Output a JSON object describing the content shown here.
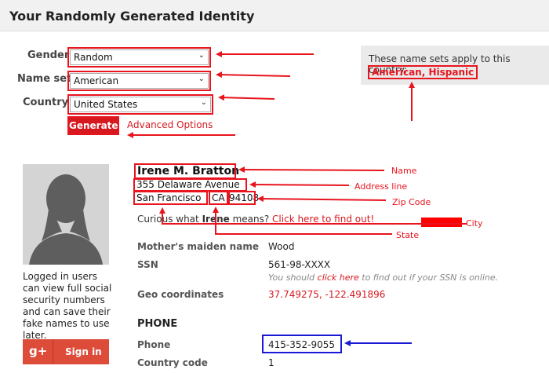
{
  "header": {
    "title": "Your Randomly Generated Identity"
  },
  "form": {
    "gender_label": "Gender",
    "gender_value": "Random",
    "nameset_label": "Name set",
    "nameset_value": "American",
    "country_label": "Country",
    "country_value": "United States",
    "generate_label": "Generate",
    "advanced_label": "Advanced Options"
  },
  "note": {
    "text": "These name sets apply to this country:",
    "value": "American, Hispanic"
  },
  "sidebar": {
    "text": "Logged in users can view full social security numbers and can save their fake names to use later.",
    "gplus_glyph": "g+",
    "signin_label": "Sign in"
  },
  "person": {
    "name": "Irene M. Bratton",
    "address_line": "355 Delaware Avenue",
    "city": "San Francisco",
    "state": "CA",
    "zip": "94108",
    "curious_prefix": "Curious what ",
    "curious_name": "Irene",
    "curious_mid": " means? ",
    "curious_link": "Click here to find out!"
  },
  "details": {
    "maiden_label": "Mother's maiden name",
    "maiden_value": "Wood",
    "ssn_label": "SSN",
    "ssn_value": "561-98-XXXX",
    "ssn_note_prefix": "You should ",
    "ssn_note_link": "click here",
    "ssn_note_suffix": " to find out if your SSN is online.",
    "geo_label": "Geo coordinates",
    "geo_value": "37.749275, -122.491896",
    "phone_section": "PHONE",
    "phone_label": "Phone",
    "phone_value": "415-352-9055",
    "cc_label": "Country code",
    "cc_value": "1"
  },
  "annotations": {
    "name": "Name",
    "address": "Address line",
    "zip": "Zip Code",
    "city": "City",
    "state": "State"
  },
  "colors": {
    "annotation_red": "#e8141e",
    "annotation_blue": "#1a1ad6",
    "brand_red": "#d6181f"
  }
}
